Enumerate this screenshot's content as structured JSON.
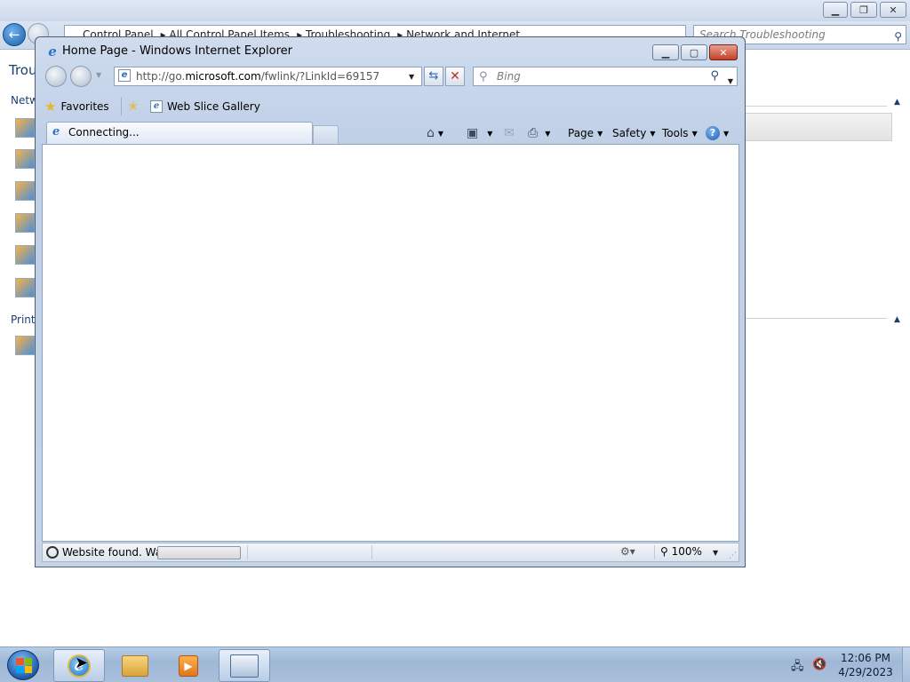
{
  "control_panel": {
    "breadcrumbs": [
      "Control Panel",
      "All Control Panel Items",
      "Troubleshooting",
      "Network and Internet"
    ],
    "search_placeholder": "Search Troubleshooting",
    "heading": "Trou",
    "section_network": "Netw",
    "section_printing": "Printi"
  },
  "ie": {
    "window_title": "Home Page - Windows Internet Explorer",
    "address_prefix": "http://go.",
    "address_domain": "microsoft.com",
    "address_suffix": "/fwlink/?LinkId=69157",
    "search_placeholder": "Bing",
    "favorites_label": "Favorites",
    "web_slice_label": "Web Slice Gallery",
    "tab_label": "Connecting...",
    "commands": {
      "page": "Page",
      "safety": "Safety",
      "tools": "Tools",
      "help": "?"
    },
    "status_text": "Website found. Wai",
    "progress_fraction": 0.0,
    "zoom": "100%"
  },
  "taskbar": {
    "time": "12:06 PM",
    "date": "4/29/2023"
  },
  "icons": [
    "back-icon",
    "forward-icon",
    "refresh-icon",
    "stop-icon",
    "search-icon",
    "home-icon",
    "feeds-icon",
    "mail-icon",
    "print-icon",
    "help-icon",
    "favorites-star-icon",
    "add-favorites-icon",
    "ie-logo-icon",
    "folder-icon",
    "media-player-icon",
    "control-panel-icon",
    "network-icon",
    "volume-muted-icon"
  ]
}
